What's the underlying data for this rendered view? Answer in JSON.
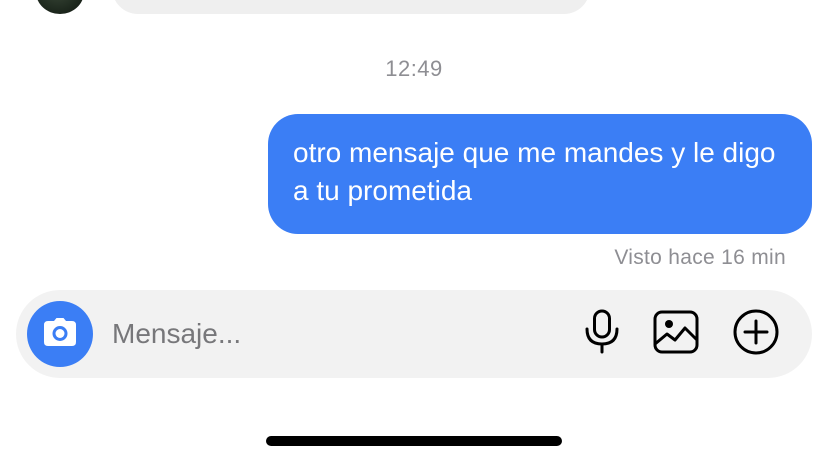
{
  "conversation": {
    "timestamp": "12:49",
    "outgoing_message": "otro mensaje que me mandes y le digo a tu prometida",
    "seen_status": "Visto hace 16 min"
  },
  "composer": {
    "placeholder": "Mensaje...",
    "camera_icon": "camera-icon",
    "mic_icon": "microphone-icon",
    "gallery_icon": "image-icon",
    "more_icon": "plus-circle-icon"
  },
  "colors": {
    "accent": "#3b7ef5",
    "incoming_bubble": "#efefef",
    "composer_bg": "#f2f2f2",
    "secondary_text": "#8e8e93"
  }
}
